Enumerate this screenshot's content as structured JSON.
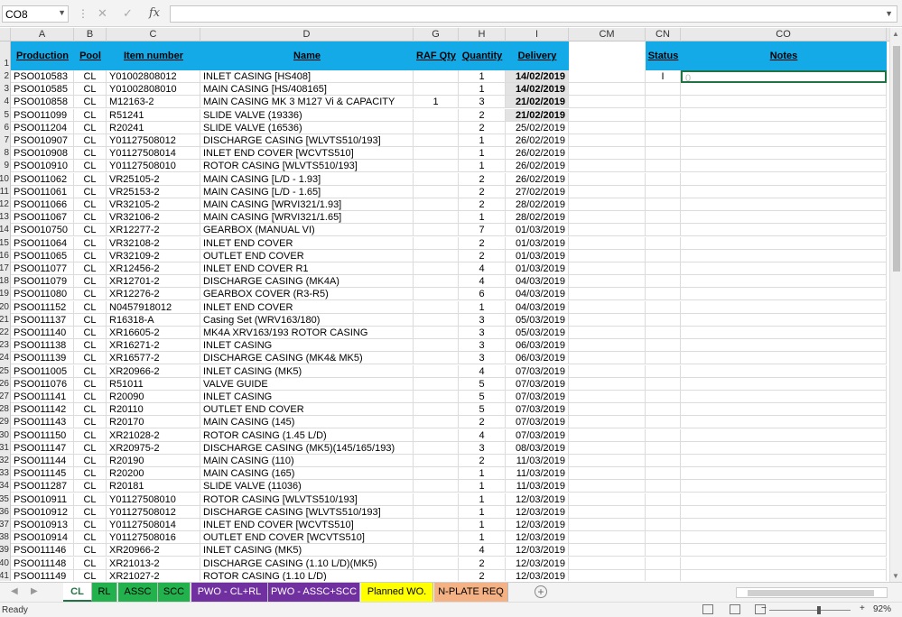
{
  "namebox": "CO8",
  "formula": "",
  "columns": [
    "A",
    "B",
    "C",
    "D",
    "G",
    "H",
    "I",
    "CM",
    "CN",
    "CO"
  ],
  "headers": {
    "production": "Production",
    "pool": "Pool",
    "item": "Item number",
    "name": "Name",
    "raf": "RAF Qty",
    "qty": "Quantity",
    "delivery": "Delivery",
    "status": "Status",
    "notes": "Notes"
  },
  "row_numbers": [
    "1",
    "2",
    "3",
    "4",
    "5",
    "6",
    "7",
    "8",
    "9",
    "10",
    "11",
    "12",
    "13",
    "14",
    "15",
    "16",
    "17",
    "18",
    "19",
    "20",
    "21",
    "22",
    "23",
    "24",
    "25",
    "26",
    "27",
    "28",
    "29",
    "30",
    "31",
    "32",
    "33",
    "34",
    "35",
    "36",
    "37",
    "38",
    "39",
    "40",
    "41"
  ],
  "status_cell": "I",
  "notes_cell": "0",
  "rows": [
    [
      "PSO010583",
      "CL",
      "Y01002808012",
      "INLET CASING [HS408]",
      "",
      "1",
      "14/02/2019"
    ],
    [
      "PSO010585",
      "CL",
      "Y01002808010",
      "MAIN CASING [HS/408165]",
      "",
      "1",
      "14/02/2019"
    ],
    [
      "PSO010858",
      "CL",
      "M12163-2",
      "MAIN CASING  MK 3 M127 Vi & CAPACITY",
      "1",
      "3",
      "21/02/2019"
    ],
    [
      "PSO011099",
      "CL",
      "R51241",
      "SLIDE VALVE (19336)",
      "",
      "2",
      "21/02/2019"
    ],
    [
      "PSO011204",
      "CL",
      "R20241",
      "SLIDE VALVE (16536)",
      "",
      "2",
      "25/02/2019"
    ],
    [
      "PSO010907",
      "CL",
      "Y01127508012",
      "DISCHARGE CASING [WLVTS510/193]",
      "",
      "1",
      "26/02/2019"
    ],
    [
      "PSO010908",
      "CL",
      "Y01127508014",
      "INLET END COVER [WCVTS510]",
      "",
      "1",
      "26/02/2019"
    ],
    [
      "PSO010910",
      "CL",
      "Y01127508010",
      "ROTOR CASING [WLVTS510/193]",
      "",
      "1",
      "26/02/2019"
    ],
    [
      "PSO011062",
      "CL",
      "VR25105-2",
      "MAIN CASING [L/D - 1.93]",
      "",
      "2",
      "26/02/2019"
    ],
    [
      "PSO011061",
      "CL",
      "VR25153-2",
      "MAIN CASING [L/D - 1.65]",
      "",
      "2",
      "27/02/2019"
    ],
    [
      "PSO011066",
      "CL",
      "VR32105-2",
      "MAIN CASING [WRVI321/1.93]",
      "",
      "2",
      "28/02/2019"
    ],
    [
      "PSO011067",
      "CL",
      "VR32106-2",
      "MAIN CASING [WRVI321/1.65]",
      "",
      "1",
      "28/02/2019"
    ],
    [
      "PSO010750",
      "CL",
      "XR12277-2",
      "GEARBOX (MANUAL VI)",
      "",
      "7",
      "01/03/2019"
    ],
    [
      "PSO011064",
      "CL",
      "VR32108-2",
      "INLET END COVER",
      "",
      "2",
      "01/03/2019"
    ],
    [
      "PSO011065",
      "CL",
      "VR32109-2",
      "OUTLET END COVER",
      "",
      "2",
      "01/03/2019"
    ],
    [
      "PSO011077",
      "CL",
      "XR12456-2",
      "INLET END COVER  R1",
      "",
      "4",
      "01/03/2019"
    ],
    [
      "PSO011079",
      "CL",
      "XR12701-2",
      "DISCHARGE CASING (MK4A)",
      "",
      "4",
      "04/03/2019"
    ],
    [
      "PSO011080",
      "CL",
      "XR12276-2",
      "GEARBOX COVER (R3-R5)",
      "",
      "6",
      "04/03/2019"
    ],
    [
      "PSO011152",
      "CL",
      "N0457918012",
      "INLET END COVER",
      "",
      "1",
      "04/03/2019"
    ],
    [
      "PSO011137",
      "CL",
      "R16318-A",
      "Casing Set (WRV163/180)",
      "",
      "3",
      "05/03/2019"
    ],
    [
      "PSO011140",
      "CL",
      "XR16605-2",
      "MK4A XRV163/193 ROTOR CASING",
      "",
      "3",
      "05/03/2019"
    ],
    [
      "PSO011138",
      "CL",
      "XR16271-2",
      "INLET CASING",
      "",
      "3",
      "06/03/2019"
    ],
    [
      "PSO011139",
      "CL",
      "XR16577-2",
      "DISCHARGE CASING (MK4& MK5)",
      "",
      "3",
      "06/03/2019"
    ],
    [
      "PSO011005",
      "CL",
      "XR20966-2",
      "INLET CASING (MK5)",
      "",
      "4",
      "07/03/2019"
    ],
    [
      "PSO011076",
      "CL",
      "R51011",
      "VALVE GUIDE",
      "",
      "5",
      "07/03/2019"
    ],
    [
      "PSO011141",
      "CL",
      "R20090",
      "INLET CASING",
      "",
      "5",
      "07/03/2019"
    ],
    [
      "PSO011142",
      "CL",
      "R20110",
      "OUTLET END COVER",
      "",
      "5",
      "07/03/2019"
    ],
    [
      "PSO011143",
      "CL",
      "R20170",
      "MAIN CASING (145)",
      "",
      "2",
      "07/03/2019"
    ],
    [
      "PSO011150",
      "CL",
      "XR21028-2",
      "ROTOR CASING (1.45 L/D)",
      "",
      "4",
      "07/03/2019"
    ],
    [
      "PSO011147",
      "CL",
      "XR20975-2",
      "DISCHARGE CASING (MK5)(145/165/193)",
      "",
      "3",
      "08/03/2019"
    ],
    [
      "PSO011144",
      "CL",
      "R20190",
      "MAIN CASING (110)",
      "",
      "2",
      "11/03/2019"
    ],
    [
      "PSO011145",
      "CL",
      "R20200",
      "MAIN CASING (165)",
      "",
      "1",
      "11/03/2019"
    ],
    [
      "PSO011287",
      "CL",
      "R20181",
      "SLIDE VALVE (11036)",
      "",
      "1",
      "11/03/2019"
    ],
    [
      "PSO010911",
      "CL",
      "Y01127508010",
      "ROTOR CASING [WLVTS510/193]",
      "",
      "1",
      "12/03/2019"
    ],
    [
      "PSO010912",
      "CL",
      "Y01127508012",
      "DISCHARGE CASING [WLVTS510/193]",
      "",
      "1",
      "12/03/2019"
    ],
    [
      "PSO010913",
      "CL",
      "Y01127508014",
      "INLET END COVER [WCVTS510]",
      "",
      "1",
      "12/03/2019"
    ],
    [
      "PSO010914",
      "CL",
      "Y01127508016",
      "OUTLET END COVER [WCVTS510]",
      "",
      "1",
      "12/03/2019"
    ],
    [
      "PSO011146",
      "CL",
      "XR20966-2",
      "INLET CASING (MK5)",
      "",
      "4",
      "12/03/2019"
    ],
    [
      "PSO011148",
      "CL",
      "XR21013-2",
      "DISCHARGE CASING (1.10 L/D)(MK5)",
      "",
      "2",
      "12/03/2019"
    ],
    [
      "PSO011149",
      "CL",
      "XR21027-2",
      "ROTOR CASING (1.10 L/D)",
      "",
      "2",
      "12/03/2019"
    ]
  ],
  "bold_rows": 4,
  "sheet_tabs": [
    {
      "label": "CL",
      "color": "#ffffff"
    },
    {
      "label": "RL",
      "color": "#22b14c"
    },
    {
      "label": "ASSC",
      "color": "#22b14c"
    },
    {
      "label": "SCC",
      "color": "#22b14c"
    },
    {
      "label": "PWO - CL+RL",
      "color": "#7030a0"
    },
    {
      "label": "PWO - ASSC+SCC",
      "color": "#7030a0"
    },
    {
      "label": "Planned WO.",
      "color": "#ffff00"
    },
    {
      "label": "N-PLATE REQ",
      "color": "#f4b183"
    }
  ],
  "status_text": "Ready",
  "zoom": "92%",
  "accent": "#14a9e7"
}
